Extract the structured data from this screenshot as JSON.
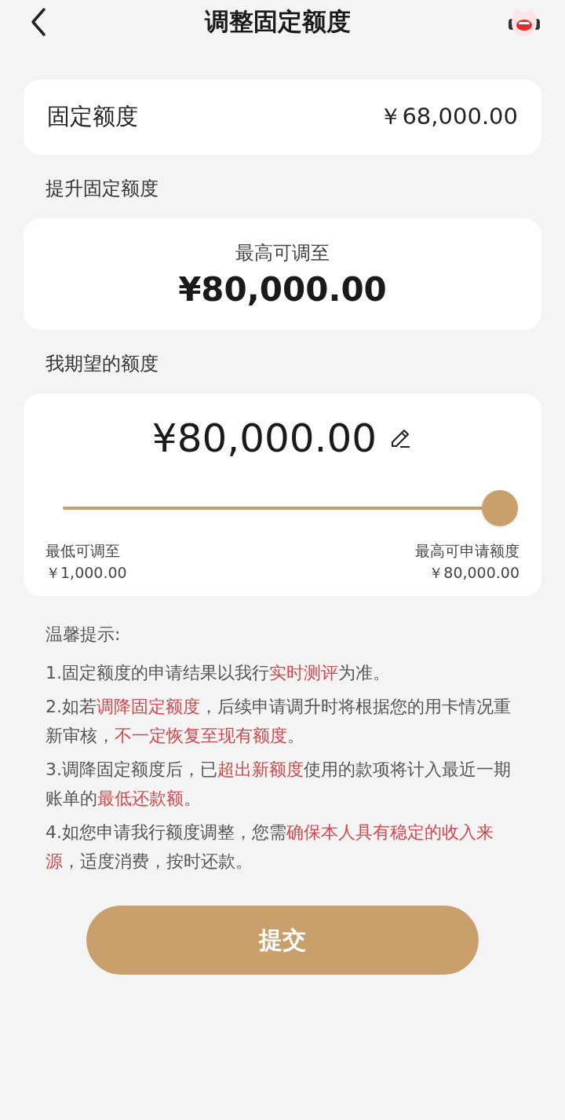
{
  "header": {
    "title": "调整固定额度"
  },
  "fixed_limit": {
    "label": "固定额度",
    "value": "￥68,000.00"
  },
  "raise_section": {
    "title": "提升固定额度",
    "caption": "最高可调至",
    "max": "¥80,000.00"
  },
  "desired_section": {
    "title": "我期望的额度",
    "amount": "¥80,000.00",
    "slider": {
      "level": 1
    },
    "min_label": "最低可调至",
    "min_value": "￥1,000.00",
    "max_label": "最高可申请额度",
    "max_value": "￥80,000.00"
  },
  "tips": {
    "title": "温馨提示:",
    "items": [
      "1.固定额度的申请结果以我行**实时测评**为准。",
      "2.如若**调降固定额度**，后续申请调升时将根据您的用卡情况重新审核，**不一定恢复至现有额度**。",
      "3.调降固定额度后，已**超出新额度**使用的款项将计入最近一期账单的**最低还款额**。",
      "4.如您申请我行额度调整，您需**确保本人具有稳定的收入来源**，适度消费，按时还款。"
    ]
  },
  "submit_button": {
    "label": "提交"
  }
}
